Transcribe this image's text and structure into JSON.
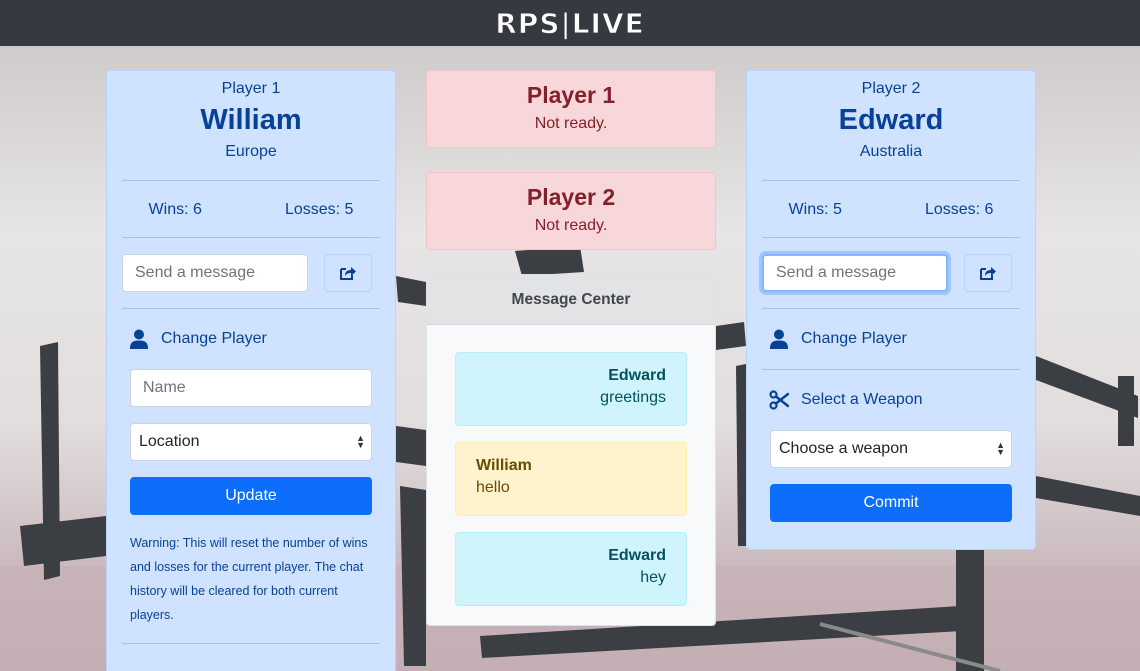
{
  "brand": "RPS|LIVE",
  "player1": {
    "label": "Player 1",
    "name": "William",
    "location": "Europe",
    "wins": "Wins: 6",
    "losses": "Losses: 5",
    "message_placeholder": "Send a message",
    "change_player": "Change Player",
    "name_placeholder": "Name",
    "location_select": "Location",
    "update_button": "Update",
    "warning": "Warning: This will reset the number of wins and losses for the current player. The chat history will be cleared for both current players."
  },
  "player2": {
    "label": "Player 2",
    "name": "Edward",
    "location": "Australia",
    "wins": "Wins: 5",
    "losses": "Losses: 6",
    "message_placeholder": "Send a message",
    "change_player": "Change Player",
    "select_weapon": "Select a Weapon",
    "weapon_select": "Choose a weapon",
    "commit_button": "Commit"
  },
  "status": {
    "p1_title": "Player 1",
    "p1_text": "Not ready.",
    "p2_title": "Player 2",
    "p2_text": "Not ready."
  },
  "message_center": {
    "title": "Message Center",
    "messages": [
      {
        "author": "Edward",
        "text": "greetings"
      },
      {
        "author": "William",
        "text": "hello"
      },
      {
        "author": "Edward",
        "text": "hey"
      }
    ]
  },
  "colors": {
    "navbar": "#343a40",
    "primary": "#0d6efd",
    "player_card_bg": "#cfe2ff",
    "danger_bg": "#f8d7da",
    "info_bg": "#cff4fc",
    "warning_bg": "#fff3cd"
  },
  "icons": {
    "share": "share-square-icon",
    "user": "user-icon",
    "weapon": "scissors-icon"
  }
}
